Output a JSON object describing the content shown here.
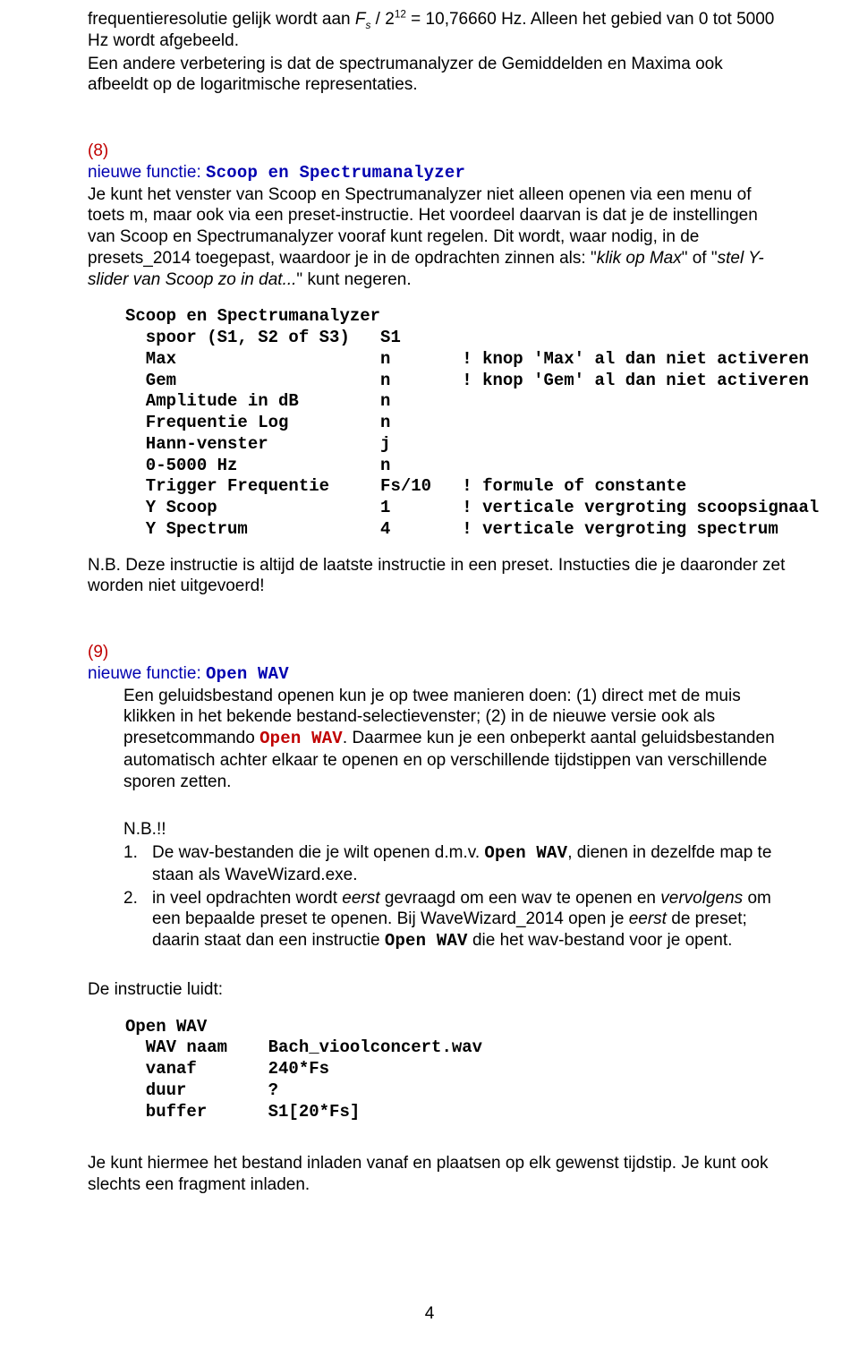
{
  "intro": {
    "line1_a": "frequentieresolutie gelijk wordt aan ",
    "line1_fs": "F",
    "line1_fs_sub": "s",
    "line1_b": " / 2",
    "line1_exp": "12",
    "line1_c": "  = 10,76660 Hz. Alleen het gebied van 0 tot 5000 Hz wordt afgebeeld.",
    "line2": "Een andere verbetering is dat de spectrumanalyzer de Gemiddelden en Maxima ook afbeeldt op de logaritmische representaties."
  },
  "s8": {
    "num": "(8)",
    "title_a": "nieuwe functie:",
    "title_b": "Scoop en Spectrumanalyzer",
    "body_a": "Je kunt het venster van Scoop en Spectrumanalyzer niet alleen openen via een menu of toets m, maar ook via een preset-instructie. Het voordeel daarvan is dat je de instellingen van Scoop en Spectrumanalyzer vooraf kunt regelen. Dit wordt, waar nodig, in de presets_2014 toegepast, waardoor je in de opdrachten zinnen als: \"",
    "body_i1": "klik op Max",
    "body_b2": "\" of \"",
    "body_i2": "stel Y-slider van Scoop zo in dat...",
    "body_c": "\" kunt negeren.",
    "code": "Scoop en Spectrumanalyzer\n  spoor (S1, S2 of S3)   S1\n  Max                    n       ! knop 'Max' al dan niet activeren\n  Gem                    n       ! knop 'Gem' al dan niet activeren\n  Amplitude in dB        n\n  Frequentie Log         n\n  Hann-venster           j\n  0-5000 Hz              n\n  Trigger Frequentie     Fs/10   ! formule of constante\n  Y Scoop                1       ! verticale vergroting scoopsignaal\n  Y Spectrum             4       ! verticale vergroting spectrum",
    "nb_lead": "N.B.",
    "nb_text": " Deze instructie is altijd de laatste instructie in een preset. Instucties die je daaronder zet worden niet uitgevoerd!"
  },
  "s9": {
    "num": "(9)",
    "title_a": "nieuwe functie:",
    "title_b": "Open WAV",
    "body_a": "Een geluidsbestand openen kun je op twee manieren doen: (1) direct met de muis klikken in het bekende bestand-selectievenster; (2) in de nieuwe versie ook als presetcommando ",
    "body_cmd": "Open WAV",
    "body_b": ". Daarmee kun je een onbeperkt aantal geluidsbestanden automatisch achter elkaar te openen en op verschillende tijdstippen van verschillende sporen zetten.",
    "nb_lead": "N.B.!!",
    "li1_num": "1.",
    "li1_a": "De wav-bestanden die je wilt openen d.m.v. ",
    "li1_cmd": "Open WAV",
    "li1_b": ", dienen in dezelfde map te staan als WaveWizard.exe.",
    "li2_num": "2.",
    "li2_a": "in veel opdrachten wordt ",
    "li2_i1": "eerst",
    "li2_b": " gevraagd om een wav te openen en ",
    "li2_i2": "vervolgens",
    "li2_c": " om een bepaalde preset te openen. Bij WaveWizard_2014 open je ",
    "li2_i3": "eerst",
    "li2_d": " de preset; daarin staat dan een instructie ",
    "li2_cmd": "Open WAV",
    "li2_e": " die het wav-bestand voor je opent.",
    "instr_lead": "De instructie luidt:",
    "code": "Open WAV\n  WAV naam    Bach_vioolconcert.wav\n  vanaf       240*Fs\n  duur        ?\n  buffer      S1[20*Fs]",
    "tail": "Je kunt hiermee het bestand inladen vanaf en plaatsen op elk gewenst tijdstip. Je kunt ook slechts een fragment inladen."
  },
  "page_number": "4"
}
